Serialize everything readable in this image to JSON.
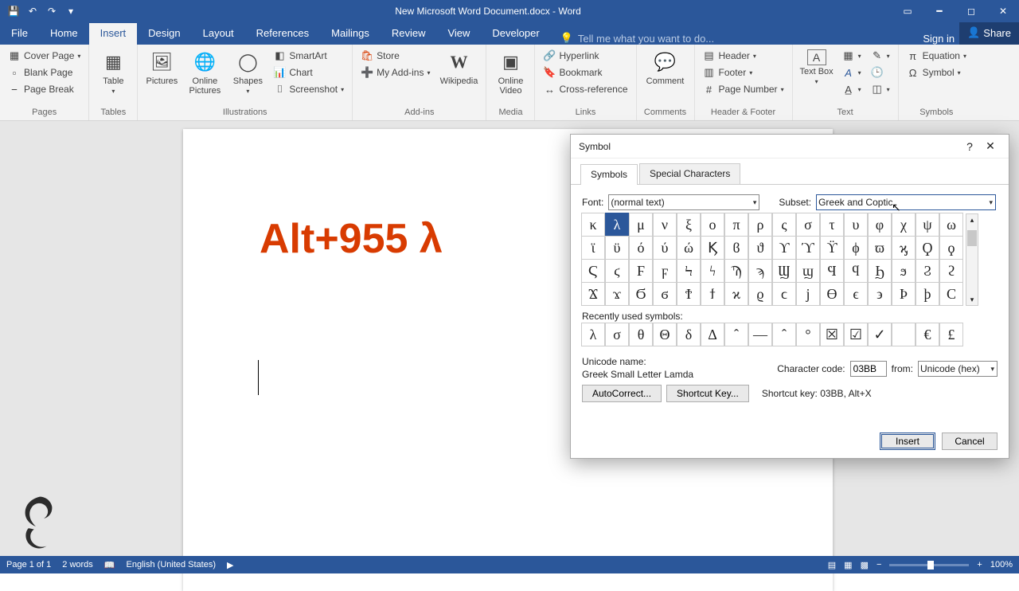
{
  "titlebar": {
    "doc_title": "New Microsoft Word Document.docx - Word"
  },
  "menubar": {
    "tabs": [
      "File",
      "Home",
      "Insert",
      "Design",
      "Layout",
      "References",
      "Mailings",
      "Review",
      "View",
      "Developer"
    ],
    "active": "Insert",
    "tellme": "Tell me what you want to do...",
    "signin": "Sign in",
    "share": "Share"
  },
  "ribbon": {
    "pages": {
      "cover": "Cover Page",
      "blank": "Blank Page",
      "break": "Page Break",
      "label": "Pages"
    },
    "tables": {
      "table": "Table",
      "label": "Tables"
    },
    "illus": {
      "pictures": "Pictures",
      "online": "Online Pictures",
      "shapes": "Shapes",
      "smartart": "SmartArt",
      "chart": "Chart",
      "screenshot": "Screenshot",
      "label": "Illustrations"
    },
    "addins": {
      "store": "Store",
      "myaddins": "My Add-ins",
      "wikipedia": "Wikipedia",
      "label": "Add-ins"
    },
    "media": {
      "video": "Online Video",
      "label": "Media"
    },
    "links": {
      "hyperlink": "Hyperlink",
      "bookmark": "Bookmark",
      "crossref": "Cross-reference",
      "label": "Links"
    },
    "comments": {
      "comment": "Comment",
      "label": "Comments"
    },
    "hf": {
      "header": "Header",
      "footer": "Footer",
      "pagenum": "Page Number",
      "label": "Header & Footer"
    },
    "text": {
      "textbox": "Text Box",
      "label": "Text"
    },
    "symbols": {
      "equation": "Equation",
      "symbol": "Symbol",
      "label": "Symbols"
    }
  },
  "document": {
    "text": "Alt+955 λ"
  },
  "status": {
    "page": "Page 1 of 1",
    "words": "2 words",
    "language": "English (United States)",
    "zoom": "100%"
  },
  "dialog": {
    "title": "Symbol",
    "tab_symbols": "Symbols",
    "tab_special": "Special Characters",
    "font_label": "Font:",
    "font_value": "(normal text)",
    "subset_label": "Subset:",
    "subset_value": "Greek and Coptic",
    "grid": [
      "κ",
      "λ",
      "μ",
      "ν",
      "ξ",
      "ο",
      "π",
      "ρ",
      "ς",
      "σ",
      "τ",
      "υ",
      "φ",
      "χ",
      "ψ",
      "ω",
      "ϊ",
      "ϋ",
      "ό",
      "ύ",
      "ώ",
      "Ϗ",
      "ϐ",
      "ϑ",
      "ϒ",
      "ϓ",
      "ϔ",
      "ϕ",
      "ϖ",
      "ϗ",
      "Ϙ",
      "ϙ",
      "Ϛ",
      "ϛ",
      "Ϝ",
      "ϝ",
      "Ϟ",
      "ϟ",
      "Ϡ",
      "ϡ",
      "Ϣ",
      "ϣ",
      "Ϥ",
      "ϥ",
      "Ϧ",
      "ϧ",
      "Ϩ",
      "ϩ",
      "Ϫ",
      "ϫ",
      "Ϭ",
      "ϭ",
      "Ϯ",
      "ϯ",
      "ϰ",
      "ϱ",
      "ϲ",
      "ϳ",
      "ϴ",
      "ϵ",
      "϶",
      "Ϸ",
      "ϸ",
      "Ϲ"
    ],
    "selected_index": 1,
    "recent_label": "Recently used symbols:",
    "recent": [
      "λ",
      "σ",
      "θ",
      "Θ",
      "δ",
      "Δ",
      "ˆ",
      "—",
      "ˆ",
      "°",
      "☒",
      "☑",
      "✓",
      "",
      "€",
      "£"
    ],
    "unicode_name_label": "Unicode name:",
    "unicode_name": "Greek Small Letter Lamda",
    "charcode_label": "Character code:",
    "charcode": "03BB",
    "from_label": "from:",
    "from_value": "Unicode (hex)",
    "autocorrect": "AutoCorrect...",
    "shortcutkey_btn": "Shortcut Key...",
    "shortcut_label": "Shortcut key: 03BB, Alt+X",
    "insert": "Insert",
    "cancel": "Cancel"
  }
}
